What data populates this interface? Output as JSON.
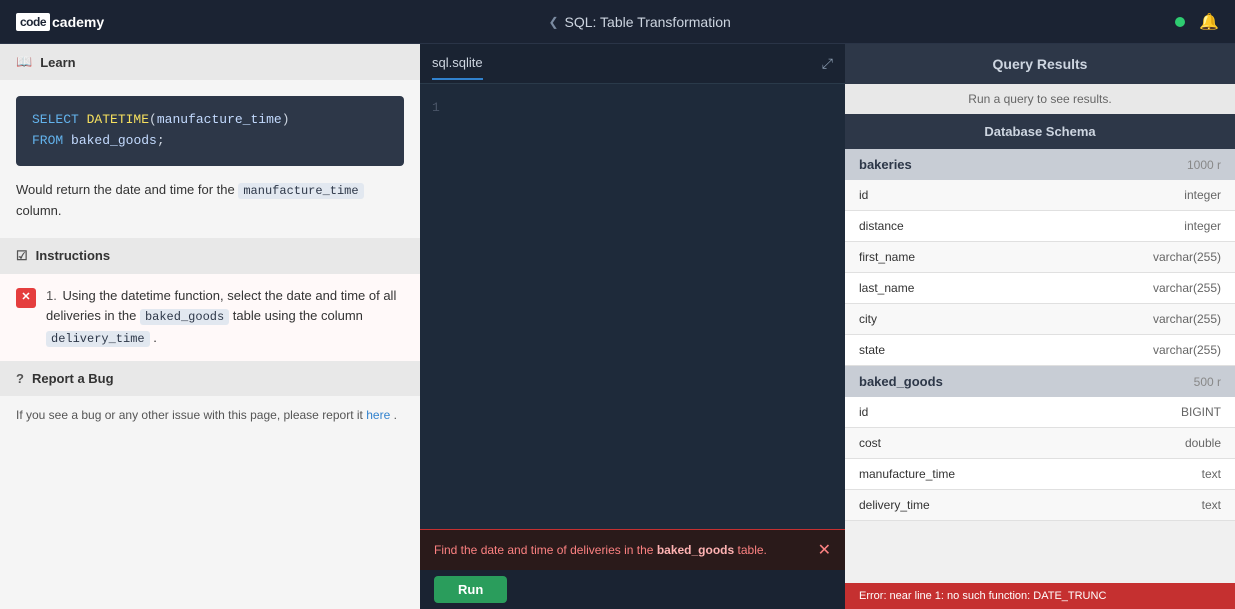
{
  "nav": {
    "logo_box": "code",
    "logo_text": "cademy",
    "title": "SQL: Table Transformation",
    "chevron": "❮"
  },
  "left_panel": {
    "learn": {
      "header": "Learn",
      "header_icon": "📖",
      "code": "SELECT DATETIME(manufacture_time)\nFROM baked_goods;",
      "code_keyword1": "SELECT",
      "code_fn": "DATETIME",
      "code_arg": "manufacture_time",
      "code_keyword2": "FROM",
      "code_table": "baked_goods",
      "text": "Would return the date and time for the",
      "inline_code": "manufacture_time",
      "text2": "column."
    },
    "instructions": {
      "header": "Instructions",
      "header_icon": "☑",
      "item_num": "1.",
      "item_text1": "Using the datetime function, select the date and time of all deliveries in the",
      "item_code1": "baked_goods",
      "item_text2": "table using the column",
      "item_code2": "delivery_time",
      "item_text3": "."
    },
    "bug_report": {
      "header": "Report a Bug",
      "header_icon": "?",
      "text1": "If you see a bug or any other issue with this page, please report it",
      "link_text": "here",
      "text2": "."
    }
  },
  "editor": {
    "tab_label": "sql.sqlite",
    "line_numbers": [
      "1"
    ],
    "hint": {
      "text1": "Find the date and time of deliveries in the",
      "text2": "baked_goods",
      "text3": "table."
    },
    "run_button": "Run"
  },
  "right_panel": {
    "query_results_title": "Query Results",
    "run_hint": "Run a query to see results.",
    "db_schema_title": "Database Schema",
    "tables": [
      {
        "name": "bakeries",
        "count": "1000 r",
        "columns": [
          {
            "name": "id",
            "type": "integer"
          },
          {
            "name": "distance",
            "type": "integer"
          },
          {
            "name": "first_name",
            "type": "varchar(255)"
          },
          {
            "name": "last_name",
            "type": "varchar(255)"
          },
          {
            "name": "city",
            "type": "varchar(255)"
          },
          {
            "name": "state",
            "type": "varchar(255)"
          }
        ]
      },
      {
        "name": "baked_goods",
        "count": "500 r",
        "columns": [
          {
            "name": "id",
            "type": "BIGINT"
          },
          {
            "name": "cost",
            "type": "double"
          },
          {
            "name": "manufacture_time",
            "type": "text"
          },
          {
            "name": "delivery_time",
            "type": "text"
          }
        ]
      }
    ],
    "error_bar": "Error: near line 1: no such function: DATE_TRUNC"
  }
}
